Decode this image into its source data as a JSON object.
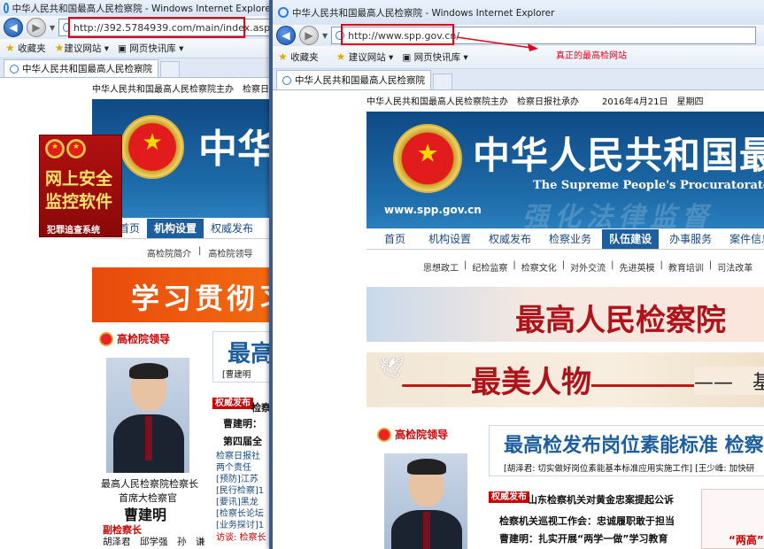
{
  "back_window": {
    "title": "中华人民共和国最高人民检察院 - Windows Internet Explorer",
    "url": "http://392.5784939.com/main/index.asp",
    "favorites_label": "收藏夹",
    "fav_items": [
      "建议网站",
      "网页快讯库"
    ],
    "tab_title": "中华人民共和国最高人民检察院",
    "top_strip": "中华人民共和国最高人民检察院主办　检察日报",
    "banner_title": "中华",
    "nav": [
      "首页",
      "机构设置",
      "权威发布"
    ],
    "subnav": [
      "高检院简介",
      "高检院领导"
    ],
    "red_banner": "学习贯彻习",
    "leaders_title": "高检院领导",
    "news_headline": "最高",
    "news_sub": "[曹建明",
    "authority_tag": "权威发布",
    "news_items": [
      "检察",
      "曹建明：",
      "第四届全",
      "检察日报社",
      "两个责任",
      "[预防]江苏",
      "[民行检察]1",
      "[要讯]黑龙",
      "[检察长论坛",
      "[业务探讨]1",
      "访谈: 检察长"
    ],
    "leader_caption1": "最高人民检察院检察长",
    "leader_caption2": "首席大检察官",
    "leader_name": "曹建明",
    "deputy_title": "副检察长",
    "deputy_names": "胡泽君　邱学强　孙　谦"
  },
  "ad": {
    "line1": "网上安全",
    "line2": "监控软件",
    "footer": "犯罪追查系统"
  },
  "front_window": {
    "title": "中华人民共和国最高人民检察院 - Windows Internet Explorer",
    "url": "http://www.spp.gov.cn/",
    "annotation": "真正的最高检网站",
    "favorites_label": "收藏夹",
    "fav_items": [
      "建议网站",
      "网页快讯库"
    ],
    "tab_title": "中华人民共和国最高人民检察院",
    "top_strip": "中华人民共和国最高人民检察院主办　检察日报社承办",
    "date": "2016年4月21日　星期四",
    "banner_title": "中华人民共和国最",
    "banner_subtitle": "The Supreme People's Procuratorate o",
    "banner_url": "www.spp.gov.cn",
    "banner_slogan": "强化法律监督",
    "nav": [
      "首页",
      "机构设置",
      "权威发布",
      "检察业务",
      "队伍建设",
      "办事服务",
      "案件信息公"
    ],
    "nav_active": "队伍建设",
    "subnav": [
      "思想政工",
      "纪检监察",
      "检察文化",
      "对外交流",
      "先进英模",
      "教育培训",
      "司法改革"
    ],
    "banner2": "最高人民检察院",
    "banner3": "最美人物",
    "banner3_tail": "——　基",
    "leaders_title": "高检院领导",
    "headline": "最高检发布岗位素能标准 检察",
    "headline_sub": "[胡泽君: 切实做好岗位素能基本标准应用实施工作]  [王少峰: 加快研",
    "authority_tag": "权威发布",
    "news1": "山东检察机关对黄金忠案提起公诉",
    "news2": "检察机关巡视工作会：忠诚履职敢于担当",
    "news3": "曹建明：扎实开展“两学一做”学习教育",
    "side_tag": "“两高”"
  },
  "colors": {
    "brand_blue": "#1d5f9e",
    "alert_red": "#e3001b",
    "gold": "#d9b340"
  },
  "icons": [
    "ie-logo-icon",
    "back-icon",
    "forward-icon",
    "star-icon",
    "national-emblem-icon",
    "arrow-annotation-icon"
  ]
}
